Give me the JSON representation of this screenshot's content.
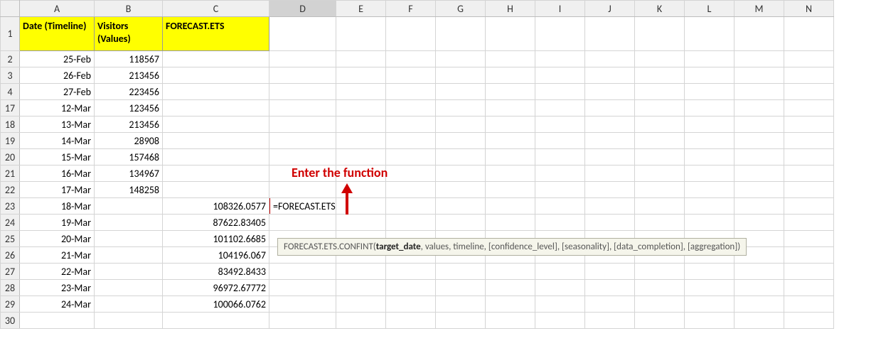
{
  "columns": [
    "A",
    "B",
    "C",
    "D",
    "E",
    "F",
    "G",
    "H",
    "I",
    "J",
    "K",
    "L",
    "M",
    "N"
  ],
  "headers": {
    "A": "Date (Timeline)",
    "B": "Visitors (Values)",
    "C": "FORECAST.ETS"
  },
  "rows": [
    {
      "num": "2",
      "A": "25-Feb",
      "B": "118567",
      "C": ""
    },
    {
      "num": "3",
      "A": "26-Feb",
      "B": "213456",
      "C": ""
    },
    {
      "num": "4",
      "A": "27-Feb",
      "B": "223456",
      "C": ""
    },
    {
      "num": "17",
      "A": "12-Mar",
      "B": "123456",
      "C": ""
    },
    {
      "num": "18",
      "A": "13-Mar",
      "B": "213456",
      "C": ""
    },
    {
      "num": "19",
      "A": "14-Mar",
      "B": "28908",
      "C": ""
    },
    {
      "num": "20",
      "A": "15-Mar",
      "B": "157468",
      "C": ""
    },
    {
      "num": "21",
      "A": "16-Mar",
      "B": "134967",
      "C": ""
    },
    {
      "num": "22",
      "A": "17-Mar",
      "B": "148258",
      "C": ""
    },
    {
      "num": "23",
      "A": "18-Mar",
      "B": "",
      "C": "108326.0577"
    },
    {
      "num": "24",
      "A": "19-Mar",
      "B": "",
      "C": "87622.83405"
    },
    {
      "num": "25",
      "A": "20-Mar",
      "B": "",
      "C": "101102.6685"
    },
    {
      "num": "26",
      "A": "21-Mar",
      "B": "",
      "C": "104196.067"
    },
    {
      "num": "27",
      "A": "22-Mar",
      "B": "",
      "C": "83492.8433"
    },
    {
      "num": "28",
      "A": "23-Mar",
      "B": "",
      "C": "96972.67772"
    },
    {
      "num": "29",
      "A": "24-Mar",
      "B": "",
      "C": "100066.0762"
    },
    {
      "num": "30",
      "A": "",
      "B": "",
      "C": ""
    }
  ],
  "formula_input": "=FORECAST.ETS.CONFINT(",
  "tooltip": {
    "fn": "FORECAST.ETS.CONFINT(",
    "bold_arg": "target_date",
    "rest": ", values, timeline, [confidence_level], [seasonality], [data_completion], [aggregation])"
  },
  "annotation": "Enter the function",
  "selected_col": "D",
  "active_row": "23"
}
